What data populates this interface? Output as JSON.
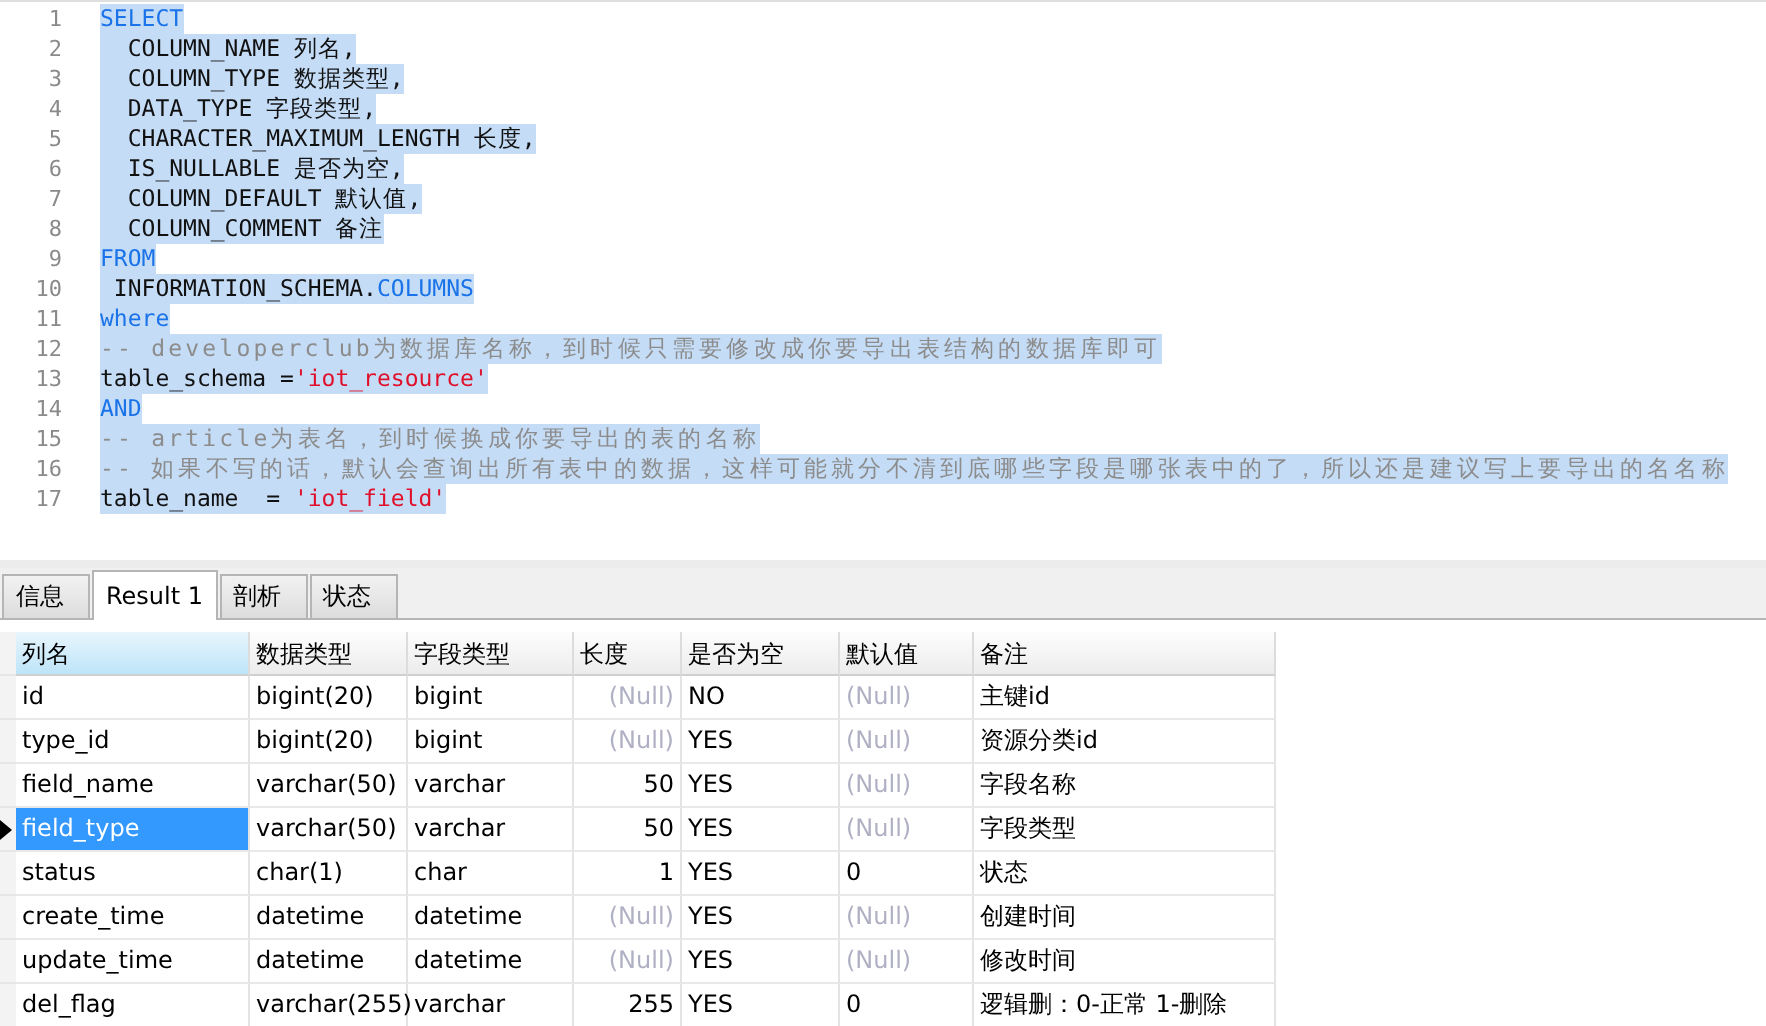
{
  "editor": {
    "lines": [
      {
        "number": "1",
        "tokens": [
          {
            "kind": "keyword",
            "text": "SELECT"
          }
        ]
      },
      {
        "number": "2",
        "tokens": [
          {
            "kind": "plain",
            "text": "  COLUMN_NAME 列名,"
          }
        ]
      },
      {
        "number": "3",
        "tokens": [
          {
            "kind": "plain",
            "text": "  COLUMN_TYPE 数据类型,"
          }
        ]
      },
      {
        "number": "4",
        "tokens": [
          {
            "kind": "plain",
            "text": "  DATA_TYPE 字段类型,"
          }
        ]
      },
      {
        "number": "5",
        "tokens": [
          {
            "kind": "plain",
            "text": "  CHARACTER_MAXIMUM_LENGTH 长度,"
          }
        ]
      },
      {
        "number": "6",
        "tokens": [
          {
            "kind": "plain",
            "text": "  IS_NULLABLE 是否为空,"
          }
        ]
      },
      {
        "number": "7",
        "tokens": [
          {
            "kind": "plain",
            "text": "  COLUMN_DEFAULT 默认值,"
          }
        ]
      },
      {
        "number": "8",
        "tokens": [
          {
            "kind": "plain",
            "text": "  COLUMN_COMMENT 备注"
          }
        ]
      },
      {
        "number": "9",
        "tokens": [
          {
            "kind": "keyword",
            "text": "FROM"
          }
        ]
      },
      {
        "number": "10",
        "tokens": [
          {
            "kind": "plain",
            "text": " INFORMATION_SCHEMA."
          },
          {
            "kind": "keyword",
            "text": "COLUMNS"
          }
        ]
      },
      {
        "number": "11",
        "tokens": [
          {
            "kind": "keyword",
            "text": "where"
          }
        ]
      },
      {
        "number": "12",
        "tokens": [
          {
            "kind": "comment",
            "text": "-- developerclub为数据库名称，到时候只需要修改成你要导出表结构的数据库即可"
          }
        ]
      },
      {
        "number": "13",
        "tokens": [
          {
            "kind": "plain",
            "text": "table_schema ="
          },
          {
            "kind": "string",
            "text": "'iot_resource'"
          }
        ]
      },
      {
        "number": "14",
        "tokens": [
          {
            "kind": "keyword",
            "text": "AND"
          }
        ]
      },
      {
        "number": "15",
        "tokens": [
          {
            "kind": "comment",
            "text": "-- article为表名，到时候换成你要导出的表的名称"
          }
        ]
      },
      {
        "number": "16",
        "tokens": [
          {
            "kind": "comment",
            "text": "-- 如果不写的话，默认会查询出所有表中的数据，这样可能就分不清到底哪些字段是哪张表中的了，所以还是建议写上要导出的名名称"
          }
        ]
      },
      {
        "number": "17",
        "tokens": [
          {
            "kind": "plain",
            "text": "table_name  = "
          },
          {
            "kind": "string",
            "text": "'iot_field'"
          }
        ]
      }
    ]
  },
  "tabs": [
    {
      "label": "信息",
      "selected": false
    },
    {
      "label": "Result 1",
      "selected": true
    },
    {
      "label": "剖析",
      "selected": false
    },
    {
      "label": "状态",
      "selected": false
    }
  ],
  "table": {
    "columns": [
      {
        "label": "列名",
        "kind": "text",
        "selected": true
      },
      {
        "label": "数据类型",
        "kind": "text",
        "selected": false
      },
      {
        "label": "字段类型",
        "kind": "text",
        "selected": false
      },
      {
        "label": "长度",
        "kind": "number",
        "selected": false
      },
      {
        "label": "是否为空",
        "kind": "text",
        "selected": false
      },
      {
        "label": "默认值",
        "kind": "text",
        "selected": false
      },
      {
        "label": "备注",
        "kind": "text",
        "selected": false
      }
    ],
    "rows": [
      {
        "selected": false,
        "cells": [
          "id",
          "bigint(20)",
          "bigint",
          "(Null)",
          "NO",
          "(Null)",
          "主键id"
        ],
        "null_flags": [
          false,
          false,
          false,
          true,
          false,
          true,
          false
        ]
      },
      {
        "selected": false,
        "cells": [
          "type_id",
          "bigint(20)",
          "bigint",
          "(Null)",
          "YES",
          "(Null)",
          "资源分类id"
        ],
        "null_flags": [
          false,
          false,
          false,
          true,
          false,
          true,
          false
        ]
      },
      {
        "selected": false,
        "cells": [
          "field_name",
          "varchar(50)",
          "varchar",
          "50",
          "YES",
          "(Null)",
          "字段名称"
        ],
        "null_flags": [
          false,
          false,
          false,
          false,
          false,
          true,
          false
        ]
      },
      {
        "selected": true,
        "cells": [
          "field_type",
          "varchar(50)",
          "varchar",
          "50",
          "YES",
          "(Null)",
          "字段类型"
        ],
        "null_flags": [
          false,
          false,
          false,
          false,
          false,
          true,
          false
        ]
      },
      {
        "selected": false,
        "cells": [
          "status",
          "char(1)",
          "char",
          "1",
          "YES",
          "0",
          "状态"
        ],
        "null_flags": [
          false,
          false,
          false,
          false,
          false,
          false,
          false
        ]
      },
      {
        "selected": false,
        "cells": [
          "create_time",
          "datetime",
          "datetime",
          "(Null)",
          "YES",
          "(Null)",
          "创建时间"
        ],
        "null_flags": [
          false,
          false,
          false,
          true,
          false,
          true,
          false
        ]
      },
      {
        "selected": false,
        "cells": [
          "update_time",
          "datetime",
          "datetime",
          "(Null)",
          "YES",
          "(Null)",
          "修改时间"
        ],
        "null_flags": [
          false,
          false,
          false,
          true,
          false,
          true,
          false
        ]
      },
      {
        "selected": false,
        "cells": [
          "del_flag",
          "varchar(255)",
          "varchar",
          "255",
          "YES",
          "0",
          "逻辑删：0-正常 1-删除"
        ],
        "null_flags": [
          false,
          false,
          false,
          false,
          false,
          false,
          false
        ]
      }
    ]
  }
}
